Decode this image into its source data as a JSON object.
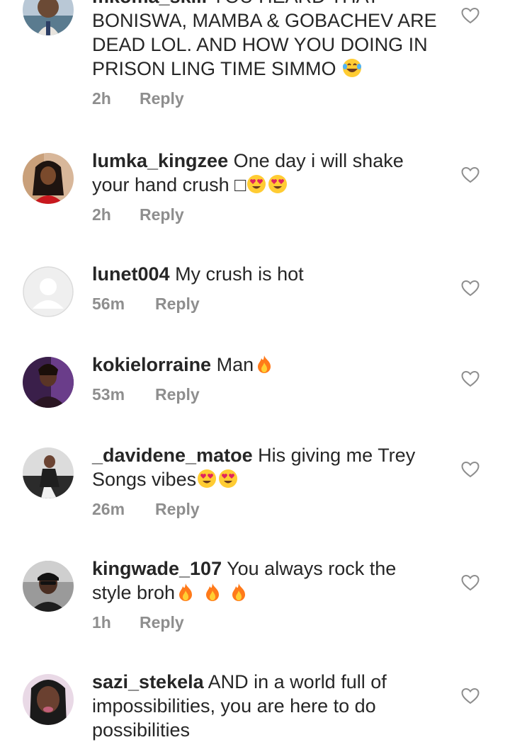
{
  "comments": [
    {
      "username": "mkoma_skill",
      "text": "YOU HEARD THAT BONISWA, MAMBA & GOBACHEV ARE DEAD LOL. AND HOW YOU DOING IN PRISON LING TIME SIMMO",
      "emojis": [
        "laughing-tears"
      ],
      "time": "2h",
      "reply": "Reply"
    },
    {
      "username": "lumka_kingzee",
      "text": "One day i will shake your hand crush □",
      "emojis": [
        "heart-eyes",
        "heart-eyes"
      ],
      "time": "2h",
      "reply": "Reply"
    },
    {
      "username": "lunet004",
      "text": "My crush is hot",
      "emojis": [],
      "time": "56m",
      "reply": "Reply"
    },
    {
      "username": "kokielorraine",
      "text": "Man",
      "emojis": [
        "fire"
      ],
      "time": "53m",
      "reply": "Reply"
    },
    {
      "username": "_davidene_matoe",
      "text": "His giving me Trey Songs vibes",
      "emojis": [
        "heart-eyes",
        "heart-eyes"
      ],
      "time": "26m",
      "reply": "Reply"
    },
    {
      "username": "kingwade_107",
      "text": "You always rock the style broh",
      "emojis": [
        "fire",
        "fire",
        "fire"
      ],
      "time": "1h",
      "reply": "Reply"
    },
    {
      "username": "sazi_stekela",
      "text": "AND in a world full of impossibilities, you are here to do possibilities",
      "emojis": [],
      "time": "",
      "reply": ""
    }
  ],
  "icons": {
    "like": "heart-outline-icon"
  },
  "colors": {
    "text": "#262626",
    "meta": "#8e8e8e",
    "heart_outline": "#8e8e8e"
  }
}
